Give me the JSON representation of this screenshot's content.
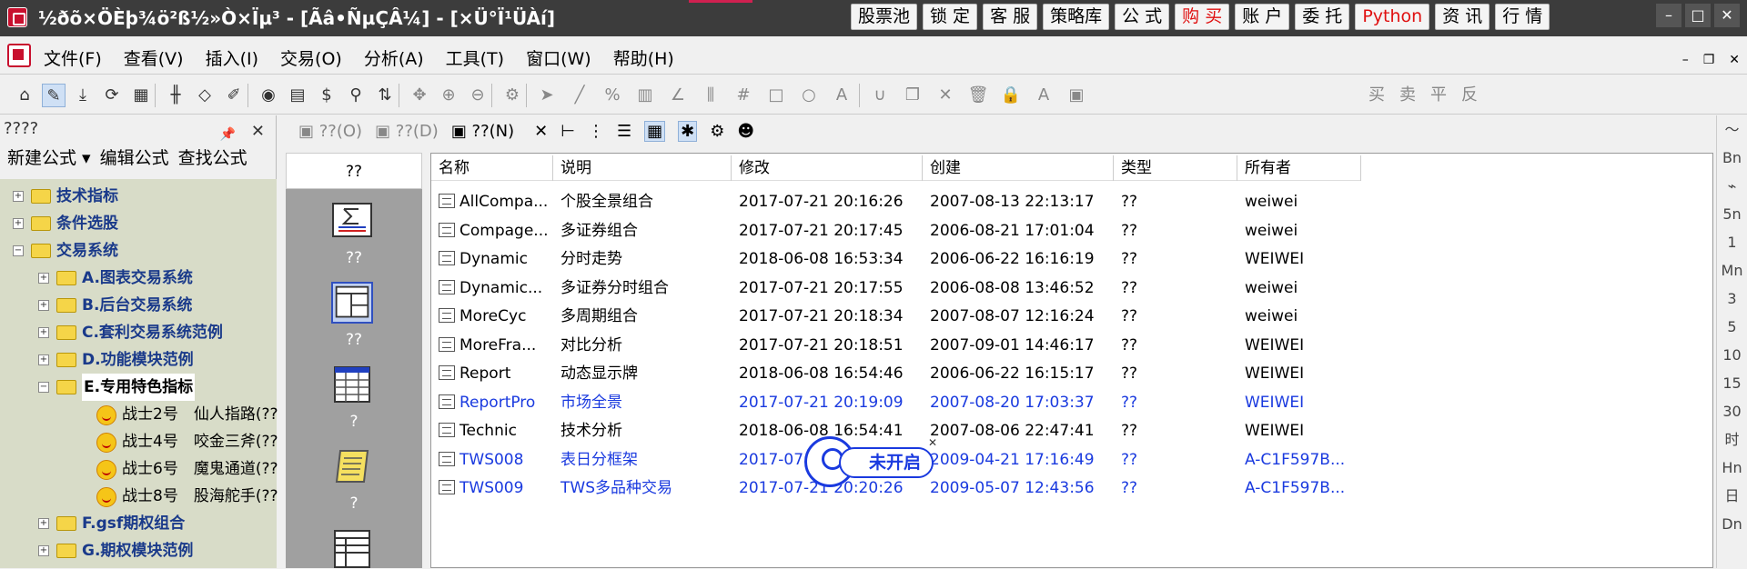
{
  "window": {
    "title": "½ðõ×ÖÈþ¾ö²ß½»Ò×Ïµ³ - [Ãâ•ÑµÇÂ¼] - [×Ü°Ï¹ÜÀí]",
    "top_buttons": [
      {
        "label": "股票池",
        "color": "#000000"
      },
      {
        "label": "锁 定",
        "color": "#000000"
      },
      {
        "label": "客 服",
        "color": "#000000"
      },
      {
        "label": "策略库",
        "color": "#000000"
      },
      {
        "label": "公 式",
        "color": "#000000"
      },
      {
        "label": "购 买",
        "color": "#e01010"
      },
      {
        "label": "账 户",
        "color": "#000000"
      },
      {
        "label": "委 托",
        "color": "#000000"
      },
      {
        "label": "Python",
        "color": "#e01010"
      },
      {
        "label": "资 讯",
        "color": "#000000"
      },
      {
        "label": "行 情",
        "color": "#000000"
      }
    ],
    "controls": {
      "minimize": "–",
      "restore": "□",
      "close": "✕"
    }
  },
  "menubar": {
    "items": [
      "文件(F)",
      "查看(V)",
      "插入(I)",
      "交易(O)",
      "分析(A)",
      "工具(T)",
      "窗口(W)",
      "帮助(H)"
    ],
    "mdi": {
      "minimize": "–",
      "restore": "❐",
      "close": "✕"
    }
  },
  "toolbar": {
    "icons": [
      "home-icon",
      "pen-icon",
      "download-icon",
      "refresh-icon",
      "grid-icon",
      "candlestick-icon",
      "diamond-icon",
      "edit-icon",
      "play-icon",
      "document-icon",
      "dollar-icon",
      "filter-icon",
      "sort-icon",
      "move-icon",
      "zoom-in-icon",
      "zoom-out-icon",
      "settings-icon",
      "cursor-icon",
      "line-icon",
      "percent-icon",
      "bars-icon",
      "angle-icon",
      "parallel-icon",
      "hash-icon",
      "rectangle-icon",
      "circle-icon",
      "text-icon",
      "magnet-icon",
      "copy-icon",
      "delete-icon",
      "trash-icon",
      "lock-icon",
      "font-color-icon",
      "save-icon"
    ],
    "trade_labels": [
      "买",
      "卖",
      "平",
      "反"
    ]
  },
  "left_panel": {
    "title": "????",
    "links": [
      "新建公式 ▾",
      "编辑公式",
      "查找公式"
    ],
    "tree": [
      {
        "label": "技术指标",
        "level": 0,
        "exp": "+"
      },
      {
        "label": "条件选股",
        "level": 0,
        "exp": "+"
      },
      {
        "label": "交易系统",
        "level": 0,
        "exp": "−"
      },
      {
        "label": "A.图表交易系统",
        "level": 1,
        "exp": "+"
      },
      {
        "label": "B.后台交易系统",
        "level": 1,
        "exp": "+"
      },
      {
        "label": "C.套利交易系统范例",
        "level": 1,
        "exp": "+"
      },
      {
        "label": "D.功能模块范例",
        "level": 1,
        "exp": "+"
      },
      {
        "label": "E.专用特色指标",
        "level": 1,
        "exp": "−",
        "selected": true
      },
      {
        "label": "战士2号　仙人指路(??",
        "level": 2,
        "leaf": true
      },
      {
        "label": "战士4号　咬金三斧(??",
        "level": 2,
        "leaf": true
      },
      {
        "label": "战士6号　魔鬼通道(??",
        "level": 2,
        "leaf": true
      },
      {
        "label": "战士8号　股海舵手(??",
        "level": 2,
        "leaf": true
      },
      {
        "label": "F.gsf期权组合",
        "level": 1,
        "exp": "+"
      },
      {
        "label": "G.期权模块范例",
        "level": 1,
        "exp": "+"
      }
    ]
  },
  "sub_toolbar": {
    "items": [
      {
        "label": "??(O)",
        "icon": "open-icon"
      },
      {
        "label": "??(D)",
        "icon": "design-icon"
      },
      {
        "label": "??(N)",
        "icon": "new-icon"
      }
    ]
  },
  "category_column": {
    "header": "??",
    "items": [
      {
        "label": "??",
        "icon": "formula-icon"
      },
      {
        "label": "??",
        "icon": "layout-icon"
      },
      {
        "label": "?",
        "icon": "table-icon"
      },
      {
        "label": "?",
        "icon": "scroll-icon"
      }
    ]
  },
  "list": {
    "headers": [
      "名称",
      "说明",
      "修改",
      "创建",
      "类型",
      "所有者"
    ],
    "rows": [
      {
        "name": "AllCompa...",
        "desc": "个股全景组合",
        "modified": "2017-07-21 20:16:26",
        "created": "2007-08-13 22:13:17",
        "type": "??",
        "owner": "weiwei",
        "blue": false
      },
      {
        "name": "Compage...",
        "desc": "多证券组合",
        "modified": "2017-07-21 20:17:45",
        "created": "2006-08-21 17:01:04",
        "type": "??",
        "owner": "weiwei",
        "blue": false
      },
      {
        "name": "Dynamic",
        "desc": "分时走势",
        "modified": "2018-06-08 16:53:34",
        "created": "2006-06-22 16:16:19",
        "type": "??",
        "owner": "WEIWEI",
        "blue": false
      },
      {
        "name": "Dynamic...",
        "desc": "多证券分时组合",
        "modified": "2017-07-21 20:17:55",
        "created": "2006-08-08 13:46:52",
        "type": "??",
        "owner": "weiwei",
        "blue": false
      },
      {
        "name": "MoreCyc",
        "desc": "多周期组合",
        "modified": "2017-07-21 20:18:34",
        "created": "2007-08-07 12:16:24",
        "type": "??",
        "owner": "weiwei",
        "blue": false
      },
      {
        "name": "MoreFra...",
        "desc": "对比分析",
        "modified": "2017-07-21 20:18:51",
        "created": "2007-09-01 14:46:17",
        "type": "??",
        "owner": "WEIWEI",
        "blue": false
      },
      {
        "name": "Report",
        "desc": "动态显示牌",
        "modified": "2018-06-08 16:54:46",
        "created": "2006-06-22 16:15:17",
        "type": "??",
        "owner": "WEIWEI",
        "blue": false
      },
      {
        "name": "ReportPro",
        "desc": "市场全景",
        "modified": "2017-07-21 20:19:09",
        "created": "2007-08-20 17:03:37",
        "type": "??",
        "owner": "WEIWEI",
        "blue": true
      },
      {
        "name": "Technic",
        "desc": "技术分析",
        "modified": "2018-06-08 16:54:41",
        "created": "2007-08-06 22:47:41",
        "type": "??",
        "owner": "WEIWEI",
        "blue": false
      },
      {
        "name": "TWS008",
        "desc": "表日分框架",
        "modified": "2017-07",
        "created": "2009-04-21 17:16:49",
        "type": "??",
        "owner": "A-C1F597B...",
        "blue": true
      },
      {
        "name": "TWS009",
        "desc": "TWS多品种交易",
        "modified": "2017-07-21 20:20:26",
        "created": "2009-05-07 12:43:56",
        "type": "??",
        "owner": "A-C1F597B...",
        "blue": true
      }
    ]
  },
  "badge": {
    "label": "未开启",
    "close": "✕"
  },
  "right_bar": {
    "items": [
      "〜",
      "Bn",
      "⌁",
      "5n",
      "1",
      "Mn",
      "3",
      "5",
      "10",
      "15",
      "30",
      "时",
      "Hn",
      "日",
      "Dn"
    ]
  }
}
